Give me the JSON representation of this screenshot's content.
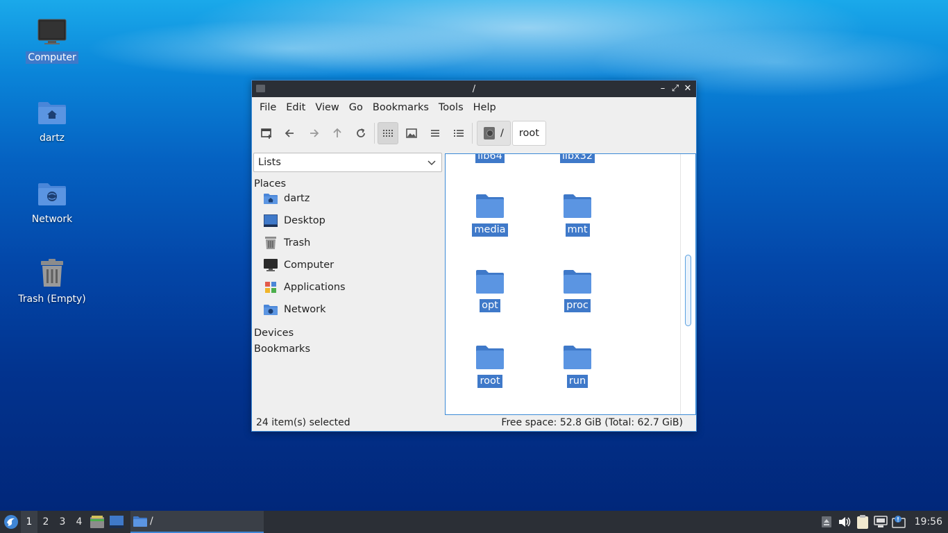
{
  "desktop": {
    "icons": [
      {
        "label": "Computer",
        "icon": "computer-icon"
      },
      {
        "label": "dartz",
        "icon": "home-folder-icon"
      },
      {
        "label": "Network",
        "icon": "network-folder-icon"
      },
      {
        "label": "Trash (Empty)",
        "icon": "trash-icon"
      }
    ]
  },
  "window": {
    "title": "/",
    "controls": {
      "minimize": "–",
      "maximize": "⤢",
      "close": "✕"
    },
    "menu": [
      "File",
      "Edit",
      "View",
      "Go",
      "Bookmarks",
      "Tools",
      "Help"
    ],
    "toolbar": {
      "buttons": [
        "new-tab-icon",
        "back-icon",
        "forward-icon",
        "up-icon",
        "reload-icon",
        "icon-view-icon",
        "thumbnail-view-icon",
        "compact-view-icon",
        "detailed-list-icon"
      ],
      "active_view": "icon-view"
    },
    "path": {
      "root_label": "/",
      "current": "root"
    },
    "sidepane": {
      "mode": "Lists",
      "places_header": "Places",
      "places": [
        {
          "label": "dartz",
          "icon": "home-folder-icon"
        },
        {
          "label": "Desktop",
          "icon": "desktop-icon"
        },
        {
          "label": "Trash",
          "icon": "trash-icon"
        },
        {
          "label": "Computer",
          "icon": "computer-icon"
        },
        {
          "label": "Applications",
          "icon": "applications-icon"
        },
        {
          "label": "Network",
          "icon": "network-folder-icon"
        }
      ],
      "devices_header": "Devices",
      "bookmarks_header": "Bookmarks"
    },
    "files": {
      "partial_top": [
        "lib64",
        "libx32"
      ],
      "items": [
        "media",
        "mnt",
        "opt",
        "proc",
        "root",
        "run"
      ]
    },
    "status": {
      "selected": "24 item(s) selected",
      "free_space": "Free space: 52.8 GiB (Total: 62.7 GiB)"
    }
  },
  "taskbar": {
    "workspaces": [
      "1",
      "2",
      "3",
      "4"
    ],
    "active_workspace": "1",
    "task_label": "/",
    "clock": "19:56"
  },
  "colors": {
    "accent": "#3f79c9",
    "titlebar": "#2b2f36",
    "folder": "#4a86d8"
  }
}
